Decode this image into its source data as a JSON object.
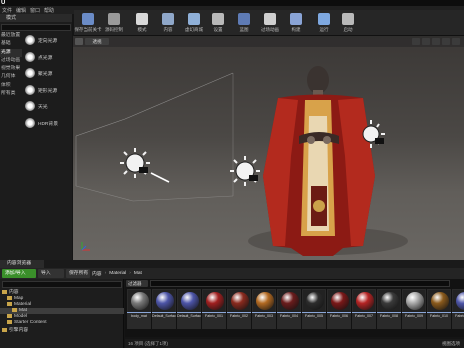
{
  "app": {
    "logo": "U",
    "icon": "unreal-logo-icon"
  },
  "menu": [
    "文件",
    "编辑",
    "窗口",
    "帮助"
  ],
  "modes_tab": "模式",
  "toolbar": [
    {
      "label": "保存当前关卡",
      "icon": "save-icon",
      "color": "#6b8cc7"
    },
    {
      "label": "源码控制",
      "icon": "source-control-icon",
      "color": "#9a9a9a"
    },
    {
      "label": "模式",
      "icon": "modes-icon",
      "color": "#d9d9d9"
    },
    {
      "label": "内容",
      "icon": "content-icon",
      "color": "#8fa7c9"
    },
    {
      "label": "虚幻商城",
      "icon": "marketplace-icon",
      "color": "#8fb0d8"
    },
    {
      "label": "设置",
      "icon": "settings-icon",
      "color": "#b9b9b9"
    },
    {
      "label": "蓝图",
      "icon": "blueprint-icon",
      "color": "#5e7bb5"
    },
    {
      "label": "过场动画",
      "icon": "cinematics-icon",
      "color": "#cfcfcf"
    },
    {
      "label": "构建",
      "icon": "build-icon",
      "color": "#8aa4d6"
    },
    {
      "label": "运行",
      "icon": "play-icon",
      "color": "#7ea8e0"
    },
    {
      "label": "启动",
      "icon": "launch-icon",
      "color": "#b9b9b9"
    }
  ],
  "left_panel": {
    "categories": [
      "最近放置",
      "基础",
      "光源",
      "过场动画",
      "视觉效果",
      "几何体",
      "体积",
      "所有类"
    ],
    "selected_category": 2,
    "lights": [
      "定向光源",
      "点光源",
      "聚光源",
      "矩形光源",
      "天光",
      "HDR背景"
    ]
  },
  "viewport": {
    "view_mode": "透视"
  },
  "content_browser": {
    "tab": "内容浏览器",
    "add_new": "添加/导入",
    "import": "导入",
    "save_all": "保存所有",
    "breadcrumb": [
      "内容",
      "Material",
      "Mat"
    ],
    "filter": "过滤器",
    "tree": [
      {
        "label": "内容",
        "depth": 0
      },
      {
        "label": "Map",
        "depth": 1
      },
      {
        "label": "Material",
        "depth": 1
      },
      {
        "label": "Mat",
        "depth": 2,
        "selected": true
      },
      {
        "label": "Model",
        "depth": 1
      },
      {
        "label": "Starter Content",
        "depth": 1
      },
      {
        "label": "引擎内容",
        "depth": 0
      }
    ],
    "assets": [
      {
        "name": "body_mat",
        "color": "#7a7a7a"
      },
      {
        "name": "Default_Surfaces_Default_Normal",
        "color": "#4d55a8"
      },
      {
        "name": "Default_Surfaces_Default_Normal",
        "color": "#4d55a8"
      },
      {
        "name": "Fabric_001",
        "color": "#a12020"
      },
      {
        "name": "Fabric_002",
        "color": "#8a2a1e"
      },
      {
        "name": "Fabric_003",
        "color": "#b36a22"
      },
      {
        "name": "Fabric_004",
        "color": "#6a1c1c"
      },
      {
        "name": "Fabric_005",
        "color": "#2c2c2c"
      },
      {
        "name": "Fabric_006",
        "color": "#7a1818"
      },
      {
        "name": "Fabric_007",
        "color": "#b52424"
      },
      {
        "name": "Fabric_008",
        "color": "#3a3a3a"
      },
      {
        "name": "Fabric_009",
        "color": "#a9a9a9"
      },
      {
        "name": "Fabric_010",
        "color": "#8a5a1c"
      },
      {
        "name": "Fabric_011",
        "color": "#4d55a8"
      }
    ],
    "status": "16 项目 (选择了1项)",
    "view_options": "视图选项"
  }
}
